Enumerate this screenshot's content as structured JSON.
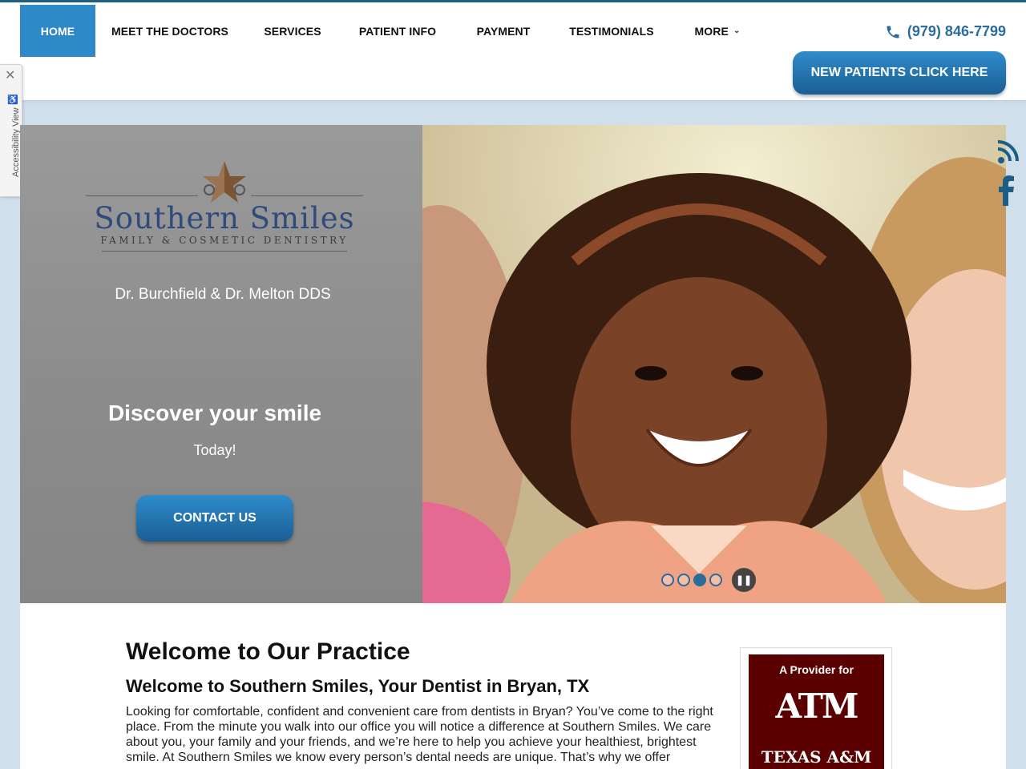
{
  "nav": {
    "items": [
      {
        "label": "HOME",
        "active": true
      },
      {
        "label": "MEET THE DOCTORS",
        "active": false
      },
      {
        "label": "SERVICES",
        "active": false
      },
      {
        "label": "PATIENT INFO",
        "active": false
      },
      {
        "label": "PAYMENT",
        "active": false
      },
      {
        "label": "TESTIMONIALS",
        "active": false
      },
      {
        "label": "MORE",
        "active": false
      }
    ],
    "more_icon": "chevron-down-icon"
  },
  "header": {
    "phone": "(979) 846-7799",
    "phone_icon": "phone-icon",
    "new_patients_label": "NEW PATIENTS CLICK HERE"
  },
  "accessibility": {
    "label": "Accessibility View",
    "close_icon": "close-icon",
    "icon": "wheelchair-icon"
  },
  "hero": {
    "logo_name": "Southern Smiles",
    "logo_subtitle": "FAMILY & COSMETIC DENTISTRY",
    "doctors": "Dr. Burchfield & Dr. Melton DDS",
    "headline": "Discover your smile",
    "subheadline": "Today!",
    "cta_label": "CONTACT US",
    "slides_count": 4,
    "active_slide": 3,
    "pause_icon": "pause-icon"
  },
  "social": [
    {
      "name": "rss-icon"
    },
    {
      "name": "facebook-icon"
    }
  ],
  "content": {
    "title": "Welcome to Our Practice",
    "subtitle": "Welcome to Southern Smiles, Your Dentist in Bryan, TX",
    "body": "Looking for comfortable, confident and convenient care from dentists in Bryan? You’ve come to the right place. From the minute you walk into our office you will notice a difference at Southern Smiles. We care about you, your family and your friends, and we’re here to help you achieve your healthiest, brightest smile. At Southern Smiles we know every person’s dental needs are unique. That’s why we offer"
  },
  "badge": {
    "top": "A Provider for",
    "logo_text": "ATM",
    "bottom": "TEXAS A&M"
  },
  "colors": {
    "primary": "#2f89c6",
    "nav_border": "#1f5e84",
    "aggie_maroon": "#5a0000"
  }
}
